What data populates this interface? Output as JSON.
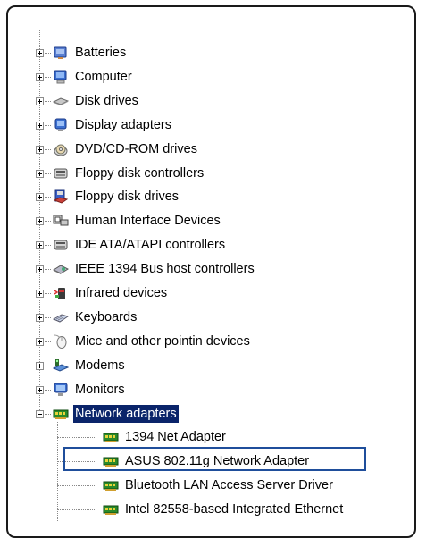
{
  "device_manager": {
    "categories": [
      {
        "label": "Batteries",
        "icon": "battery-icon"
      },
      {
        "label": "Computer",
        "icon": "computer-icon"
      },
      {
        "label": "Disk drives",
        "icon": "disk-drive-icon"
      },
      {
        "label": "Display adapters",
        "icon": "display-adapter-icon"
      },
      {
        "label": "DVD/CD-ROM drives",
        "icon": "dvd-drive-icon"
      },
      {
        "label": "Floppy disk controllers",
        "icon": "floppy-controller-icon"
      },
      {
        "label": "Floppy disk drives",
        "icon": "floppy-drive-icon"
      },
      {
        "label": "Human Interface Devices",
        "icon": "hid-icon"
      },
      {
        "label": "IDE ATA/ATAPI controllers",
        "icon": "ide-controller-icon"
      },
      {
        "label": "IEEE 1394 Bus host controllers",
        "icon": "ieee1394-icon"
      },
      {
        "label": "Infrared devices",
        "icon": "infrared-icon"
      },
      {
        "label": "Keyboards",
        "icon": "keyboard-icon"
      },
      {
        "label": "Mice and other pointin  devices",
        "icon": "mouse-icon"
      },
      {
        "label": "Modems",
        "icon": "modem-icon"
      },
      {
        "label": "Monitors",
        "icon": "monitor-icon"
      },
      {
        "label": "Network adapters",
        "icon": "network-adapter-icon",
        "expanded": true,
        "selected": true
      }
    ],
    "network_adapters": [
      {
        "label": "1394 Net Adapter",
        "icon": "network-card-icon"
      },
      {
        "label": "ASUS 802.11g Network Adapter",
        "icon": "network-card-icon",
        "highlighted": true
      },
      {
        "label": "Bluetooth LAN Access Server Driver",
        "icon": "network-card-icon"
      },
      {
        "label": "Intel 82558-based Integrated Ethernet",
        "icon": "network-card-icon"
      }
    ]
  },
  "colors": {
    "selection": "#0a246a",
    "highlight_box": "#1f4e9b",
    "frame_border": "#1a1a1a"
  }
}
